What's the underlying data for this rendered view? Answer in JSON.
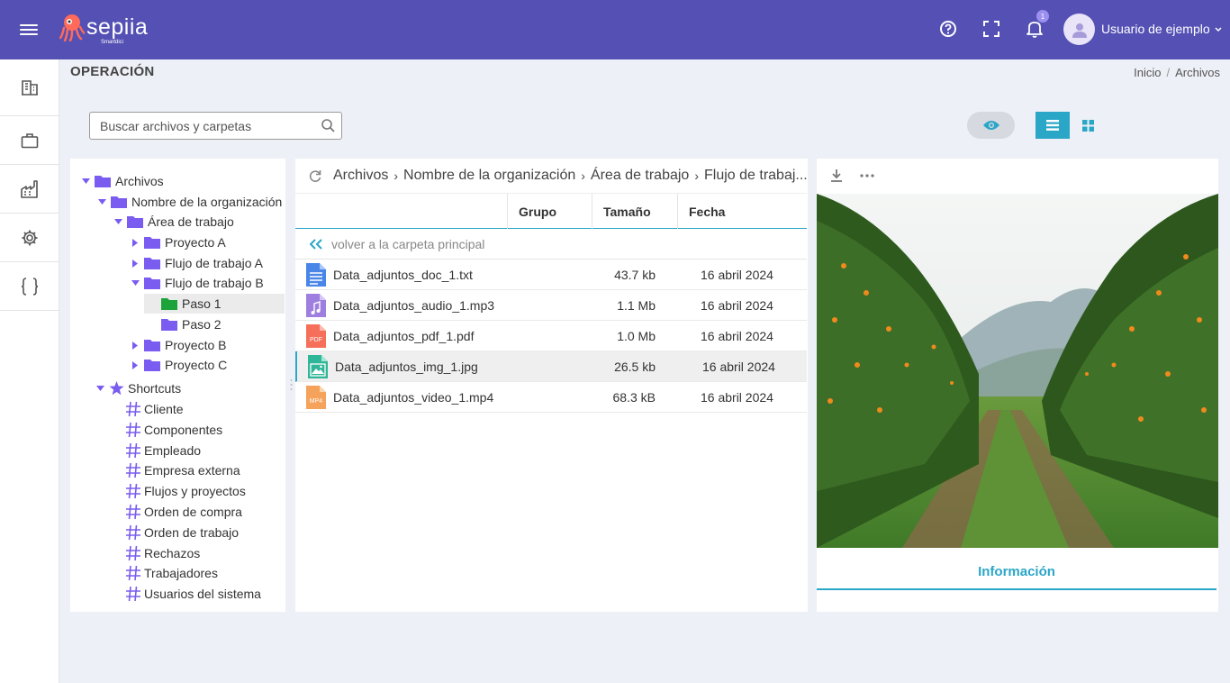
{
  "app": {
    "logo_text": "sepiia",
    "logo_sub": "Smartdici",
    "user_name": "Usuario de ejemplo",
    "notification_count": "1",
    "brand_color": "#5450b4",
    "accent_color": "#2aa6c7",
    "folder_color": "#7a5cf0"
  },
  "topbar_icons": [
    "menu-icon",
    "help-icon",
    "fullscreen-icon",
    "bell-icon",
    "user-icon",
    "chevron-down-icon"
  ],
  "rail": [
    {
      "icon": "building-icon"
    },
    {
      "icon": "briefcase-icon"
    },
    {
      "icon": "factory-icon"
    },
    {
      "icon": "gear-icon"
    },
    {
      "icon": "braces-icon"
    }
  ],
  "header": {
    "title": "OPERACIÓN",
    "breadcrumb": [
      "Inicio",
      "/",
      "Archivos"
    ]
  },
  "search": {
    "placeholder": "Buscar archivos y carpetas"
  },
  "tree": {
    "root": "Archivos",
    "org": "Nombre de la organización",
    "area": "Área de trabajo",
    "proyecto_a": "Proyecto A",
    "flujo_a": "Flujo de trabajo A",
    "flujo_b": "Flujo de trabajo B",
    "paso_1": "Paso 1",
    "paso_2": "Paso 2",
    "proyecto_b": "Proyecto B",
    "proyecto_c": "Proyecto C",
    "shortcuts_label": "Shortcuts",
    "shortcuts": [
      "Cliente",
      "Componentes",
      "Empleado",
      "Empresa externa",
      "Flujos y proyectos",
      "Orden de compra",
      "Orden de trabajo",
      "Rechazos",
      "Trabajadores",
      "Usuarios del sistema"
    ]
  },
  "path": [
    "Archivos",
    "Nombre de la organización",
    "Área de trabajo",
    "Flujo de trabaj..."
  ],
  "table": {
    "columns": [
      "Grupo",
      "Tamaño",
      "Fecha"
    ],
    "back_label": "volver a la carpeta principal",
    "rows": [
      {
        "name": "Data_adjuntos_doc_1.txt",
        "size": "43.7 kb",
        "date": "16 abril 2024",
        "icon": "txt-file-icon"
      },
      {
        "name": "Data_adjuntos_audio_1.mp3",
        "size": "1.1 Mb",
        "date": "16 abril 2024",
        "icon": "audio-file-icon"
      },
      {
        "name": "Data_adjuntos_pdf_1.pdf",
        "size": "1.0 Mb",
        "date": "16 abril 2024",
        "icon": "pdf-file-icon"
      },
      {
        "name": "Data_adjuntos_img_1.jpg",
        "size": "26.5 kb",
        "date": "16 abril 2024",
        "icon": "image-file-icon"
      },
      {
        "name": "Data_adjuntos_video_1.mp4",
        "size": "68.3 kB",
        "date": "16 abril 2024",
        "icon": "video-file-icon"
      }
    ],
    "selected_row": 3
  },
  "preview": {
    "info_tab": "Información",
    "file_badges": {
      "pdf": "PDF",
      "mp4": "MP4"
    }
  }
}
